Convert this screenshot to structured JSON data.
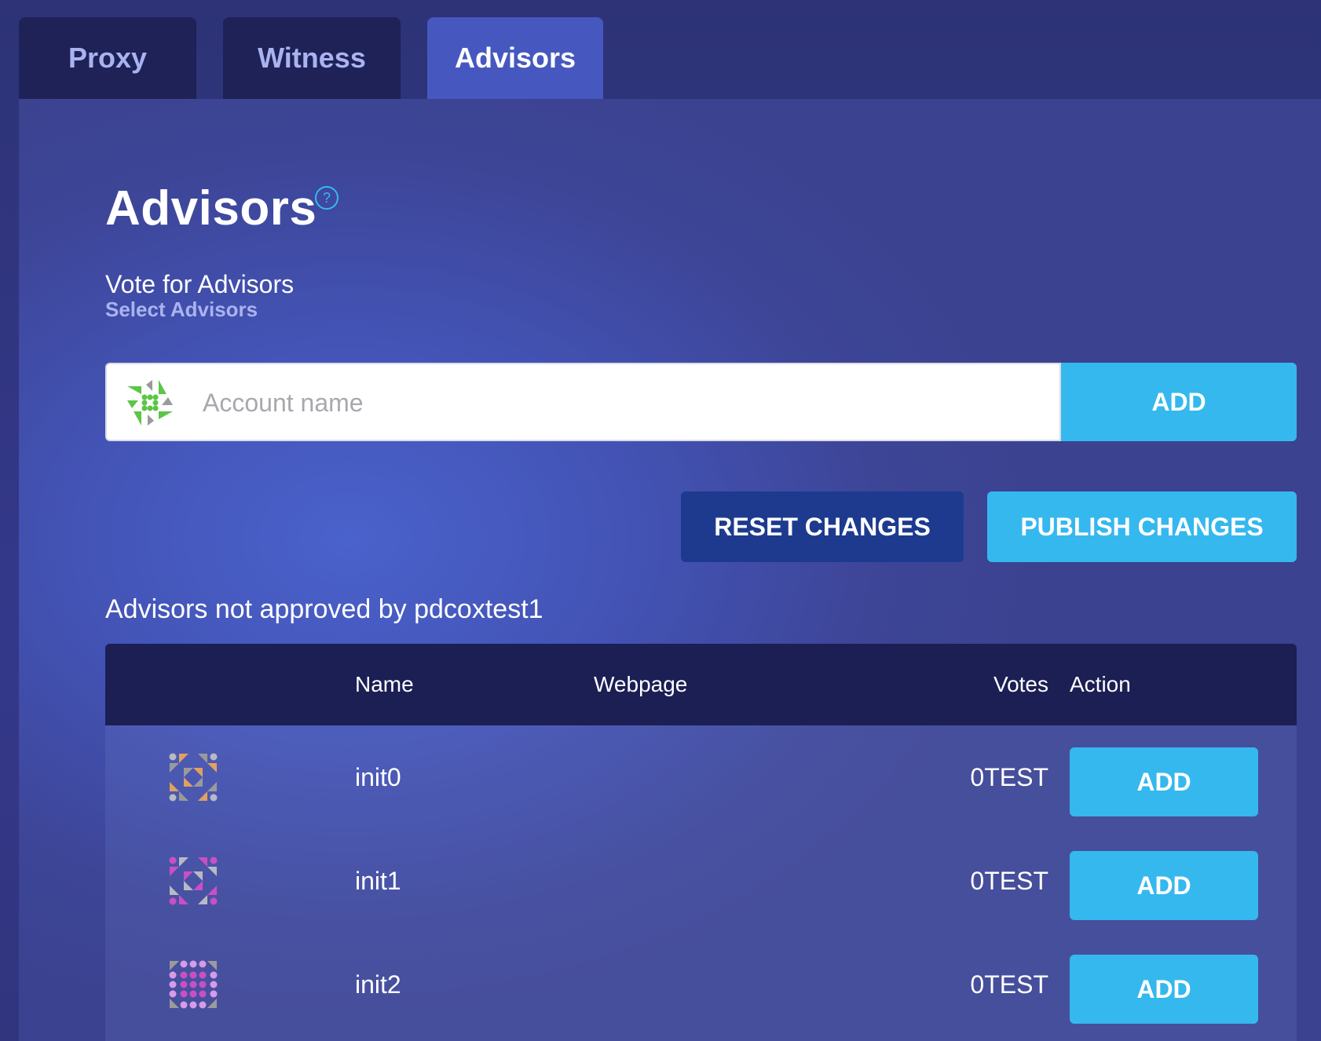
{
  "tabs": [
    {
      "label": "Proxy",
      "active": false
    },
    {
      "label": "Witness",
      "active": false
    },
    {
      "label": "Advisors",
      "active": true
    }
  ],
  "page": {
    "title": "Advisors",
    "help_icon": "question-circle-icon",
    "help_glyph": "?",
    "section_title": "Vote for Advisors",
    "section_subtitle": "Select Advisors"
  },
  "search": {
    "placeholder": "Account name",
    "value": "",
    "add_label": "ADD"
  },
  "actions": {
    "reset_label": "RESET CHANGES",
    "publish_label": "PUBLISH CHANGES"
  },
  "list": {
    "title": "Advisors not approved by pdcoxtest1",
    "columns": {
      "name": "Name",
      "webpage": "Webpage",
      "votes": "Votes",
      "action": "Action"
    },
    "rows": [
      {
        "name": "init0",
        "webpage": "",
        "votes": "0TEST",
        "action_label": "ADD",
        "avatar_color": "#e0a060"
      },
      {
        "name": "init1",
        "webpage": "",
        "votes": "0TEST",
        "action_label": "ADD",
        "avatar_color": "#c94fc4"
      },
      {
        "name": "init2",
        "webpage": "",
        "votes": "0TEST",
        "action_label": "ADD",
        "avatar_color": "#d79be8"
      }
    ]
  },
  "colors": {
    "accent": "#35b8ee",
    "reset_button": "#1d3a8f",
    "header_bg": "#1c1f54",
    "tab_active": "#4658c0",
    "tab_inactive": "#1e2257",
    "search_avatar_color": "#5cc645"
  }
}
